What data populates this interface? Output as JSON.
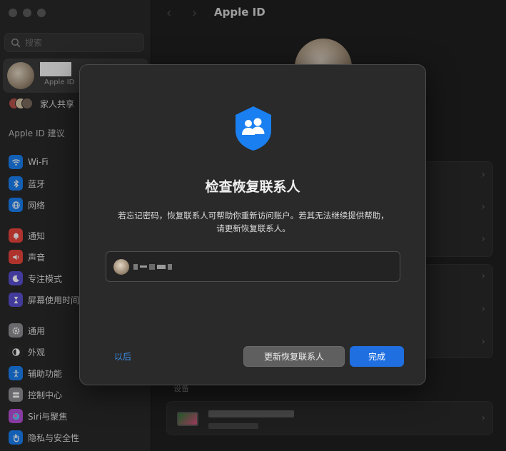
{
  "window": {
    "title": "Apple ID"
  },
  "sidebar": {
    "search_placeholder": "搜索",
    "account_sublabel": "Apple ID",
    "family_label": "家人共享",
    "suggestions_label": "Apple ID 建议",
    "items": [
      {
        "label": "Wi-Fi",
        "icon": "wifi-icon",
        "color": "#1a7ff0"
      },
      {
        "label": "蓝牙",
        "icon": "bluetooth-icon",
        "color": "#1a7ff0"
      },
      {
        "label": "网络",
        "icon": "globe-icon",
        "color": "#1a7ff0"
      },
      {
        "label": "通知",
        "icon": "bell-icon",
        "color": "#e8453c"
      },
      {
        "label": "声音",
        "icon": "speaker-icon",
        "color": "#e8453c"
      },
      {
        "label": "专注模式",
        "icon": "moon-icon",
        "color": "#5a4fcf"
      },
      {
        "label": "屏幕使用时间",
        "icon": "hourglass-icon",
        "color": "#5a4fcf"
      },
      {
        "label": "通用",
        "icon": "gear-icon",
        "color": "#8e8e93"
      },
      {
        "label": "外观",
        "icon": "appearance-icon",
        "color": "#2b2b2b"
      },
      {
        "label": "辅助功能",
        "icon": "accessibility-icon",
        "color": "#1a7ff0"
      },
      {
        "label": "控制中心",
        "icon": "control-center-icon",
        "color": "#8e8e93"
      },
      {
        "label": "Siri与聚焦",
        "icon": "siri-icon",
        "color": "#b44fd6"
      },
      {
        "label": "隐私与安全性",
        "icon": "hand-icon",
        "color": "#1a7ff0"
      }
    ]
  },
  "main": {
    "title": "Apple ID",
    "devices_label": "设备"
  },
  "dialog": {
    "title": "检查恢复联系人",
    "body": "若忘记密码，恢复联系人可帮助你重新访问账户。若其无法继续提供帮助，请更新恢复联系人。",
    "later_label": "以后",
    "update_label": "更新恢复联系人",
    "done_label": "完成",
    "accent_color": "#1f6fe0",
    "shield_color": "#1a7ff0"
  }
}
